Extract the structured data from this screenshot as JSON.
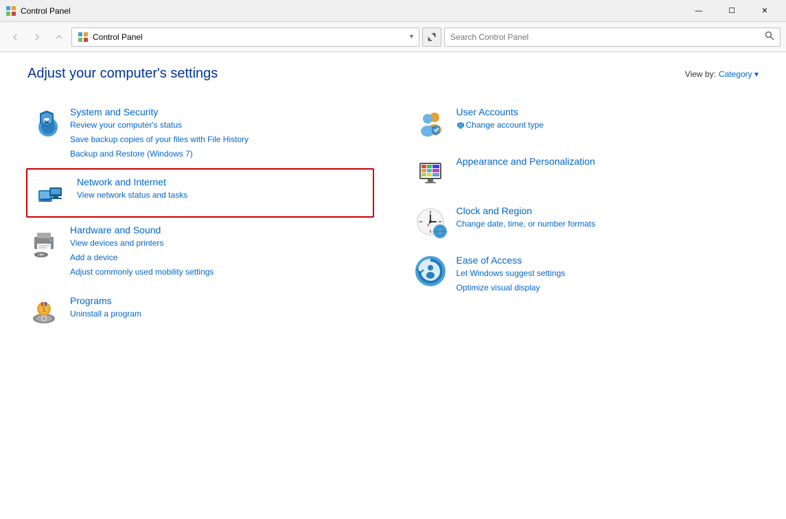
{
  "titleBar": {
    "icon": "control-panel-icon",
    "title": "Control Panel",
    "minimizeLabel": "—",
    "maximizeLabel": "☐",
    "closeLabel": "✕"
  },
  "navBar": {
    "backTooltip": "Back",
    "forwardTooltip": "Forward",
    "upTooltip": "Up",
    "addressText": "Control Panel",
    "refreshTooltip": "Refresh",
    "searchPlaceholder": "Search Control Panel"
  },
  "header": {
    "pageTitle": "Adjust your computer's settings",
    "viewByLabel": "View by:",
    "viewByValue": "Category"
  },
  "categories": {
    "left": [
      {
        "id": "system-security",
        "title": "System and Security",
        "highlighted": false,
        "links": [
          "Review your computer's status",
          "Save backup copies of your files with File History",
          "Backup and Restore (Windows 7)"
        ]
      },
      {
        "id": "network-internet",
        "title": "Network and Internet",
        "highlighted": true,
        "links": [
          "View network status and tasks"
        ]
      },
      {
        "id": "hardware-sound",
        "title": "Hardware and Sound",
        "highlighted": false,
        "links": [
          "View devices and printers",
          "Add a device",
          "Adjust commonly used mobility settings"
        ]
      },
      {
        "id": "programs",
        "title": "Programs",
        "highlighted": false,
        "links": [
          "Uninstall a program"
        ]
      }
    ],
    "right": [
      {
        "id": "user-accounts",
        "title": "User Accounts",
        "highlighted": false,
        "links": [
          "Change account type"
        ]
      },
      {
        "id": "appearance",
        "title": "Appearance and Personalization",
        "highlighted": false,
        "links": []
      },
      {
        "id": "clock-region",
        "title": "Clock and Region",
        "highlighted": false,
        "links": [
          "Change date, time, or number formats"
        ]
      },
      {
        "id": "ease-access",
        "title": "Ease of Access",
        "highlighted": false,
        "links": [
          "Let Windows suggest settings",
          "Optimize visual display"
        ]
      }
    ]
  }
}
